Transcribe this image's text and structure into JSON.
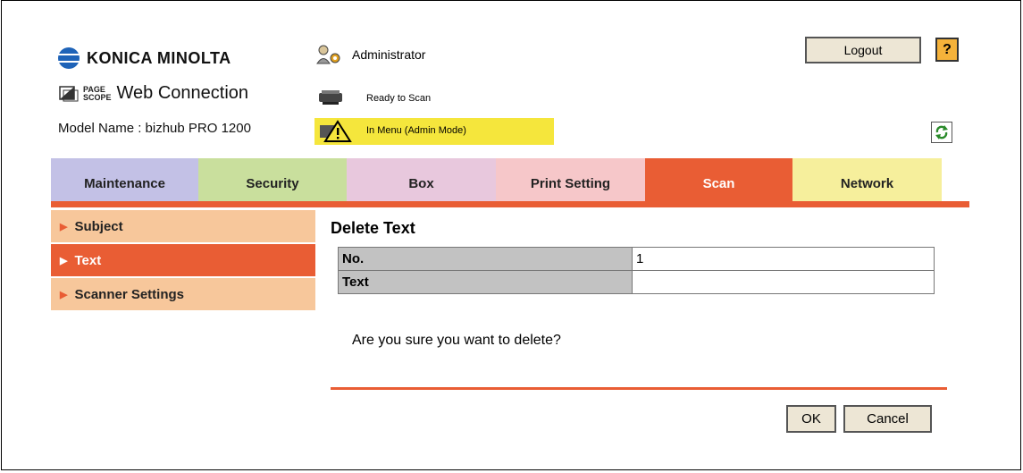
{
  "header": {
    "brand": "KONICA MINOLTA",
    "pagescope_small_top": "PAGE",
    "pagescope_small_bottom": "SCOPE",
    "pagescope_title": "Web Connection",
    "model_name": "Model Name : bizhub PRO 1200",
    "user": "Administrator",
    "status_ready": "Ready to Scan",
    "status_menu": "In Menu (Admin Mode)",
    "logout_label": "Logout",
    "help_label": "?"
  },
  "tabs": [
    {
      "label": "Maintenance",
      "color": "#c3c1e6"
    },
    {
      "label": "Security",
      "color": "#c9df9d"
    },
    {
      "label": "Box",
      "color": "#e8c8dd"
    },
    {
      "label": "Print Setting",
      "color": "#f6c7c9"
    },
    {
      "label": "Scan",
      "color": "#e95d34",
      "active": true
    },
    {
      "label": "Network",
      "color": "#f6ef9c"
    }
  ],
  "menu": {
    "items": [
      {
        "label": "Subject"
      },
      {
        "label": "Text",
        "active": true
      },
      {
        "label": "Scanner Settings"
      }
    ]
  },
  "content": {
    "title": "Delete Text",
    "rows": [
      {
        "label": "No.",
        "value": "1"
      },
      {
        "label": "Text",
        "value": ""
      }
    ],
    "confirm_text": "Are you sure you want to delete?",
    "ok_label": "OK",
    "cancel_label": "Cancel"
  },
  "colors": {
    "accent": "#e95d34",
    "status_highlight": "#f5e63c",
    "menu_inactive": "#f7c79b"
  }
}
